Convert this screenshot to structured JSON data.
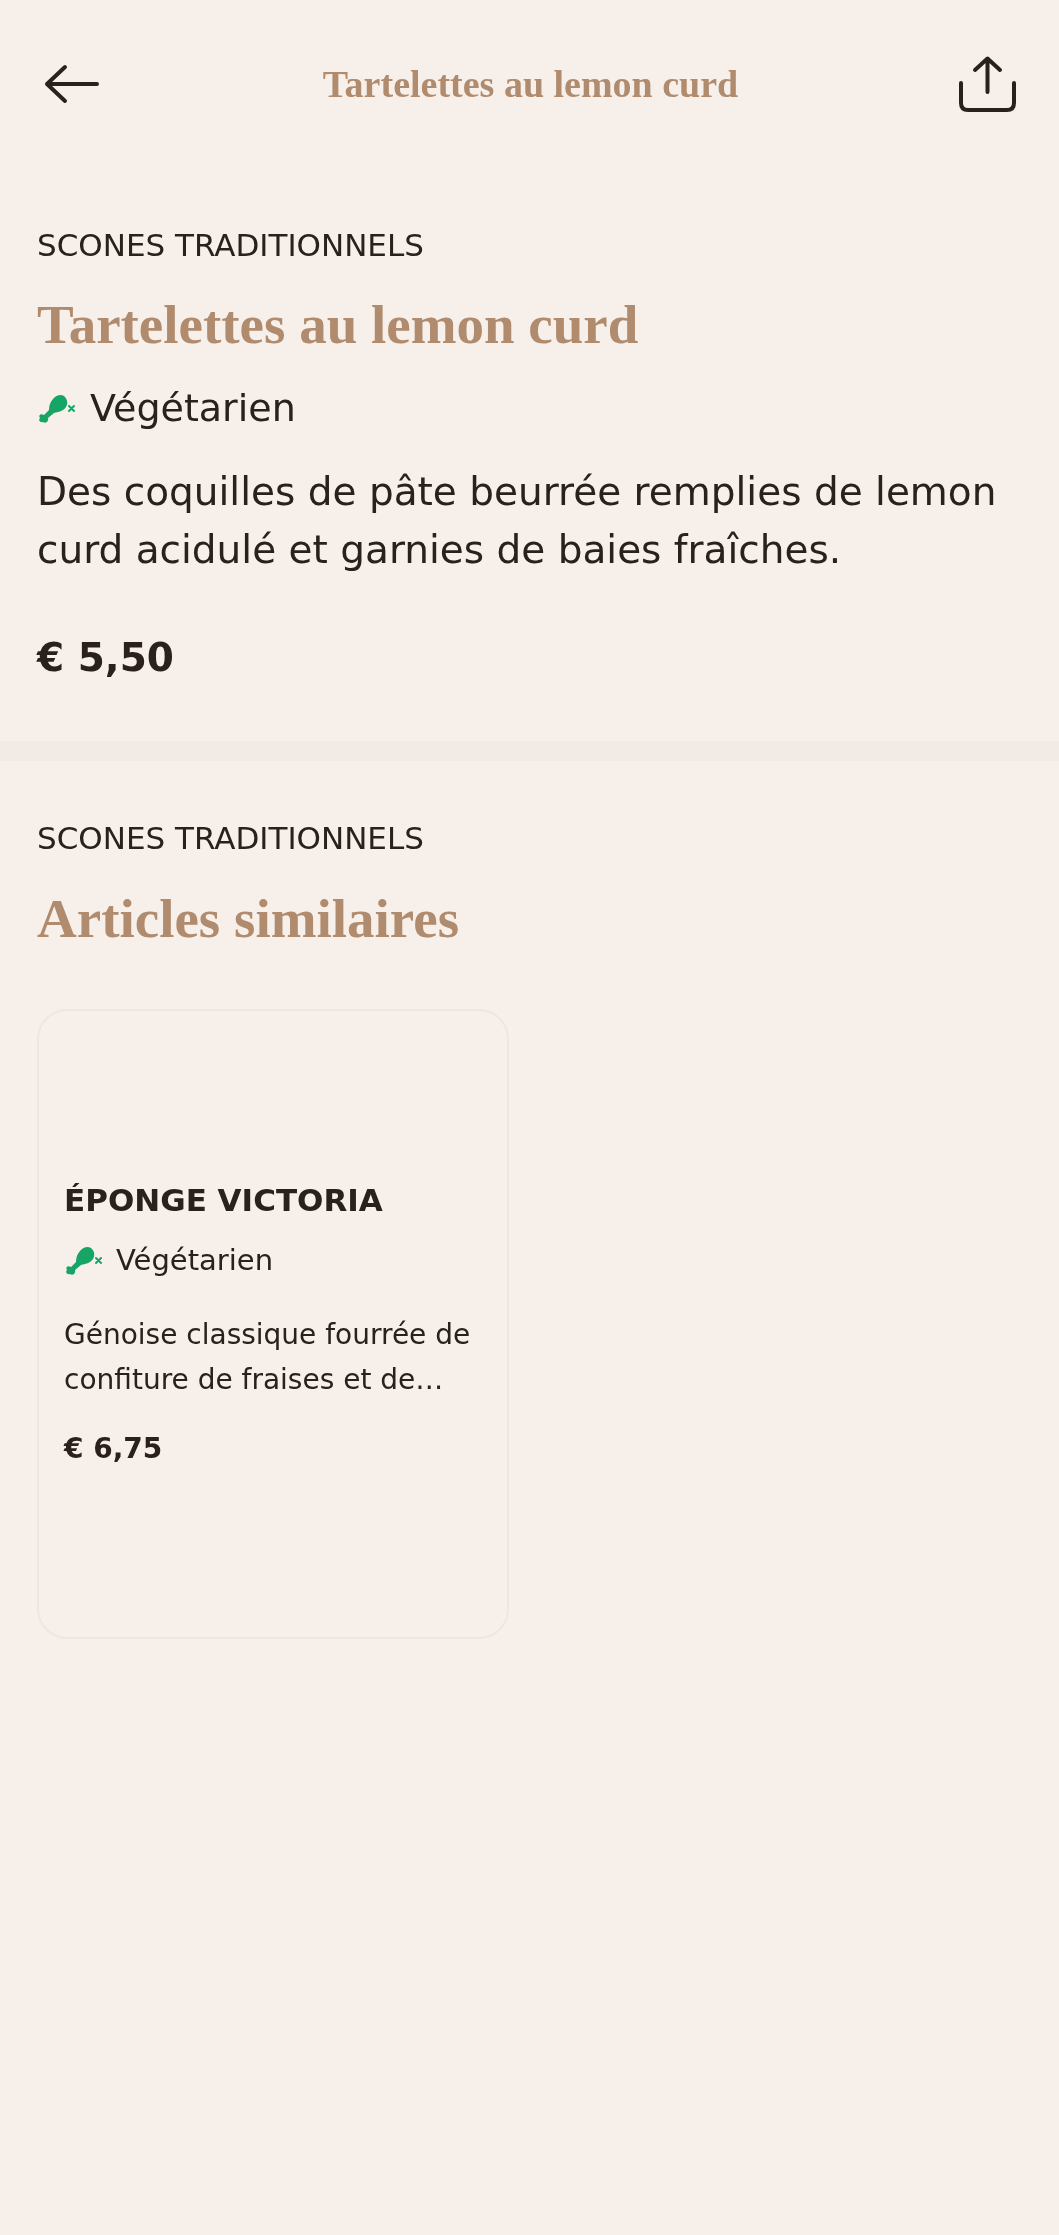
{
  "header": {
    "title": "Tartelettes au lemon curd"
  },
  "product": {
    "category": "SCONES TRADITIONNELS",
    "name": "Tartelettes au lemon curd",
    "tags": [
      {
        "label": "Végétarien"
      }
    ],
    "description": "Des coquilles de pâte beurrée remplies de lemon curd acidulé et garnies de baies fraîches.",
    "price": "€ 5,50"
  },
  "similar": {
    "category": "SCONES TRADITIONNELS",
    "title": "Articles similaires",
    "items": [
      {
        "name": "ÉPONGE VICTORIA",
        "tags": [
          {
            "label": "Végétarien"
          }
        ],
        "description": "Génoise classique fourrée de confiture de fraises et de…",
        "price": "€ 6,75"
      }
    ]
  }
}
